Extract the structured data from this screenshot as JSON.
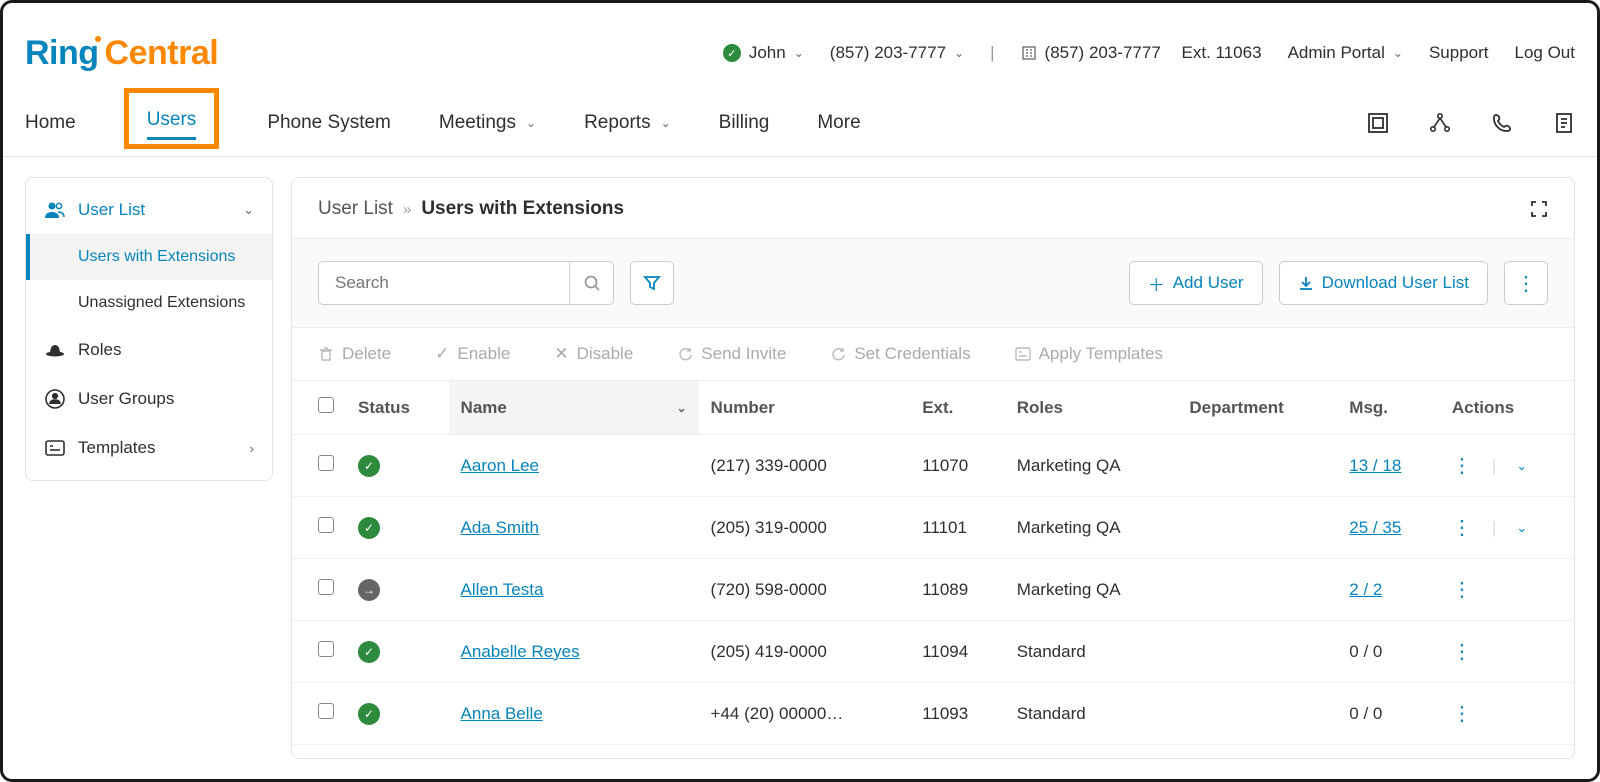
{
  "logo": {
    "part1": "Ring",
    "part2": "Central"
  },
  "topbar": {
    "user": "John",
    "phone1": "(857) 203-7777",
    "phone2": "(857) 203-7777",
    "ext_label": "Ext. 11063",
    "portal": "Admin Portal",
    "support": "Support",
    "logout": "Log Out"
  },
  "nav": {
    "home": "Home",
    "users": "Users",
    "phone": "Phone System",
    "meetings": "Meetings",
    "reports": "Reports",
    "billing": "Billing",
    "more": "More"
  },
  "sidebar": {
    "user_list": "User List",
    "users_ext": "Users with Extensions",
    "unassigned": "Unassigned Extensions",
    "roles": "Roles",
    "user_groups": "User Groups",
    "templates": "Templates"
  },
  "crumb": {
    "c1": "User List",
    "c2": "Users with Extensions"
  },
  "toolbar": {
    "search_ph": "Search",
    "add_user": "Add User",
    "download": "Download User List"
  },
  "bulk": {
    "delete": "Delete",
    "enable": "Enable",
    "disable": "Disable",
    "send_invite": "Send Invite",
    "set_credentials": "Set Credentials",
    "apply_templates": "Apply Templates"
  },
  "columns": {
    "status": "Status",
    "name": "Name",
    "number": "Number",
    "ext": "Ext.",
    "roles": "Roles",
    "department": "Department",
    "msg": "Msg.",
    "actions": "Actions"
  },
  "rows": [
    {
      "status": "active",
      "name": "Aaron Lee",
      "number": "(217) 339-0000",
      "ext": "11070",
      "role": "Marketing QA",
      "dept": "",
      "msg": "13 / 18",
      "msg_link": true,
      "expand": true
    },
    {
      "status": "active",
      "name": "Ada Smith",
      "number": "(205) 319-0000",
      "ext": "11101",
      "role": "Marketing QA",
      "dept": "",
      "msg": "25 / 35",
      "msg_link": true,
      "expand": true
    },
    {
      "status": "pending",
      "name": "Allen Testa",
      "number": "(720) 598-0000",
      "ext": "11089",
      "role": "Marketing QA",
      "dept": "",
      "msg": "2 / 2",
      "msg_link": true,
      "expand": false
    },
    {
      "status": "active",
      "name": "Anabelle Reyes",
      "number": "(205) 419-0000",
      "ext": "11094",
      "role": "Standard",
      "dept": "",
      "msg": "0 / 0",
      "msg_link": false,
      "expand": false
    },
    {
      "status": "active",
      "name": "Anna Belle",
      "number": "+44 (20) 00000…",
      "ext": "11093",
      "role": "Standard",
      "dept": "",
      "msg": "0 / 0",
      "msg_link": false,
      "expand": false
    }
  ]
}
